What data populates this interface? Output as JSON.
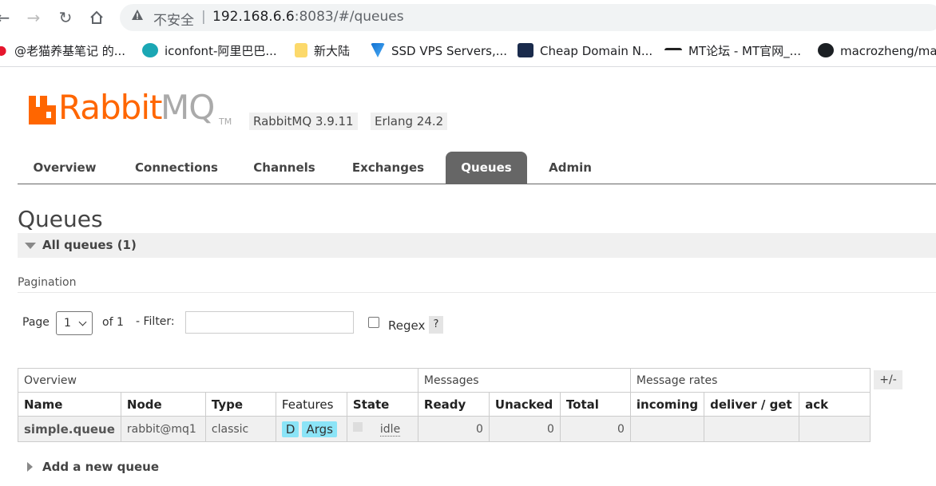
{
  "browser": {
    "security_label": "不安全",
    "separator": "|",
    "url_host": "192.168.6.6",
    "url_rest": ":8083/#/queues",
    "bookmarks": [
      {
        "label": "@老猫养基笔记 的..."
      },
      {
        "label": "iconfont-阿里巴巴..."
      },
      {
        "label": "新大陆"
      },
      {
        "label": "SSD VPS Servers,..."
      },
      {
        "label": "Cheap Domain N..."
      },
      {
        "label": "MT论坛 - MT官网_..."
      },
      {
        "label": "macrozheng/ma"
      }
    ]
  },
  "header": {
    "logo_rabbit": "Rabbit",
    "logo_mq": "MQ",
    "logo_tm": "TM",
    "rabbitmq_version": "RabbitMQ 3.9.11",
    "erlang_version": "Erlang 24.2"
  },
  "tabs": [
    {
      "label": "Overview"
    },
    {
      "label": "Connections"
    },
    {
      "label": "Channels"
    },
    {
      "label": "Exchanges"
    },
    {
      "label": "Queues",
      "active": true
    },
    {
      "label": "Admin"
    }
  ],
  "page": {
    "title": "Queues",
    "section_label": "All queues (1)",
    "pagination_label": "Pagination"
  },
  "filters": {
    "page_label": "Page",
    "page_value": "1",
    "of_label": "of 1",
    "filter_label": "- Filter:",
    "filter_value": "",
    "regex_label": "Regex",
    "help_label": "?"
  },
  "table": {
    "groups": [
      "Overview",
      "Messages",
      "Message rates"
    ],
    "columns_toggle": "+/-",
    "headers": [
      "Name",
      "Node",
      "Type",
      "Features",
      "State",
      "Ready",
      "Unacked",
      "Total",
      "incoming",
      "deliver / get",
      "ack"
    ],
    "rows": [
      {
        "name": "simple.queue",
        "node": "rabbit@mq1",
        "type": "classic",
        "features": [
          "D",
          "Args"
        ],
        "state": "idle",
        "ready": "0",
        "unacked": "0",
        "total": "0",
        "incoming": "",
        "deliver_get": "",
        "ack": ""
      }
    ]
  },
  "add_queue_label": "Add a new queue",
  "colors": {
    "brand": "#ff6600",
    "tab_active": "#666666",
    "feature_badge": "#8be4f7"
  }
}
